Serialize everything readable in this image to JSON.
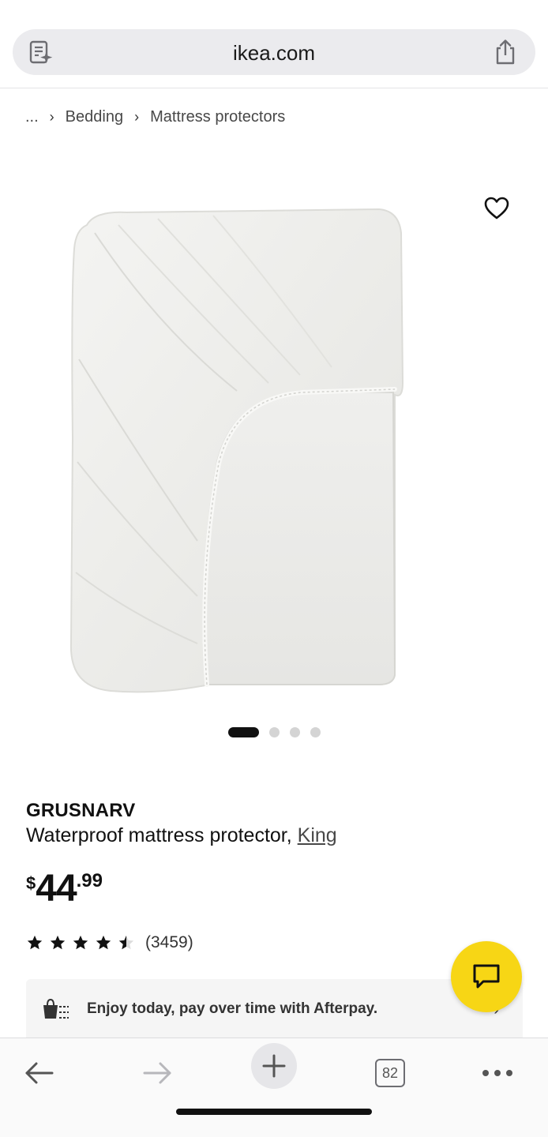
{
  "browser": {
    "domain": "ikea.com",
    "reader_icon": "reader-sparkle-icon",
    "share_icon": "share-icon"
  },
  "breadcrumb": {
    "ellipsis": "...",
    "items": [
      "Bedding",
      "Mattress protectors"
    ]
  },
  "product": {
    "brand": "GRUSNARV",
    "description": "Waterproof mattress protector,",
    "size_link": "King",
    "price": {
      "currency": "$",
      "integer": "44",
      "decimal": ".99"
    },
    "rating": {
      "value": 4.5,
      "max": 5,
      "count": "(3459)"
    },
    "image_alt": "White fitted waterproof mattress protector",
    "carousel": {
      "total": 4,
      "active": 1
    }
  },
  "afterpay": {
    "text": "Enjoy today, pay over time with Afterpay."
  },
  "chat": {
    "icon": "chat-bubble-icon",
    "color": "#f7d615"
  },
  "toolbar": {
    "tab_count": "82"
  },
  "colors": {
    "brand_yellow": "#f7d615",
    "text_dark": "#111111",
    "address_bar": "#ebebee"
  }
}
